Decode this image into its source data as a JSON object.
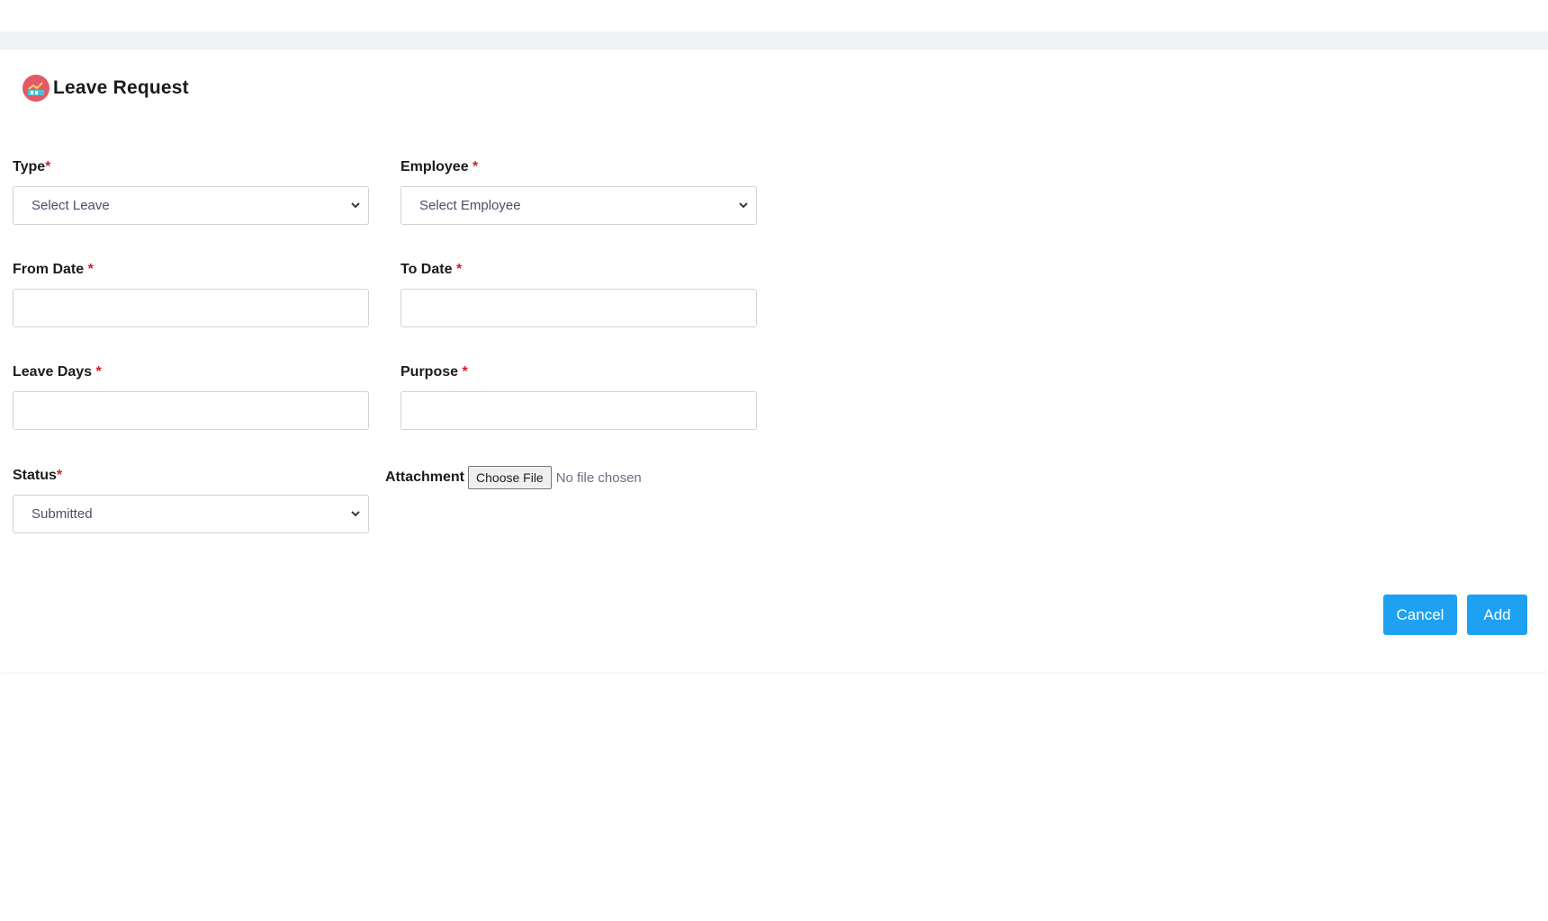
{
  "form": {
    "title": "Leave Request",
    "required_mark": "*",
    "fields": {
      "type": {
        "label": "Type",
        "value": "Select Leave"
      },
      "employee": {
        "label": "Employee",
        "value": "Select Employee"
      },
      "from_date": {
        "label": "From Date",
        "value": ""
      },
      "to_date": {
        "label": "To Date",
        "value": ""
      },
      "leave_days": {
        "label": "Leave Days",
        "value": ""
      },
      "purpose": {
        "label": "Purpose",
        "value": ""
      },
      "status": {
        "label": "Status",
        "value": "Submitted"
      },
      "attachment": {
        "label": "Attachment",
        "button": "Choose File",
        "status": "No file chosen"
      }
    },
    "actions": {
      "cancel": "Cancel",
      "add": "Add"
    }
  },
  "colors": {
    "accent": "#1ea1f1",
    "required": "#d21f2b",
    "logo": "#e05a6a"
  },
  "icons": {
    "logo": "leave-chart-icon",
    "dropdown": "chevron-down-icon"
  }
}
